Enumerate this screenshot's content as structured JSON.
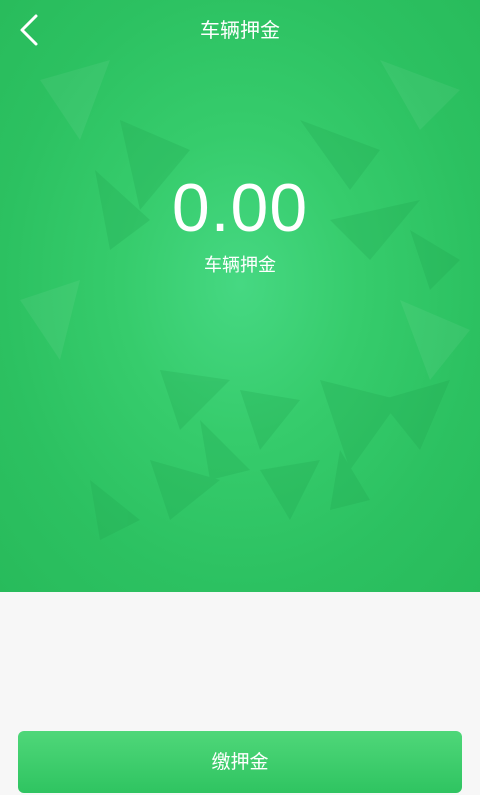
{
  "header": {
    "title": "车辆押金",
    "back_icon": "chevron-left-icon"
  },
  "deposit": {
    "amount": "0.00",
    "label": "车辆押金"
  },
  "actions": {
    "pay_label": "缴押金"
  },
  "colors": {
    "primary_green": "#2cc161",
    "highlight_green": "#46d882",
    "page_background": "#f7f7f7",
    "text_on_green": "#ffffff"
  }
}
